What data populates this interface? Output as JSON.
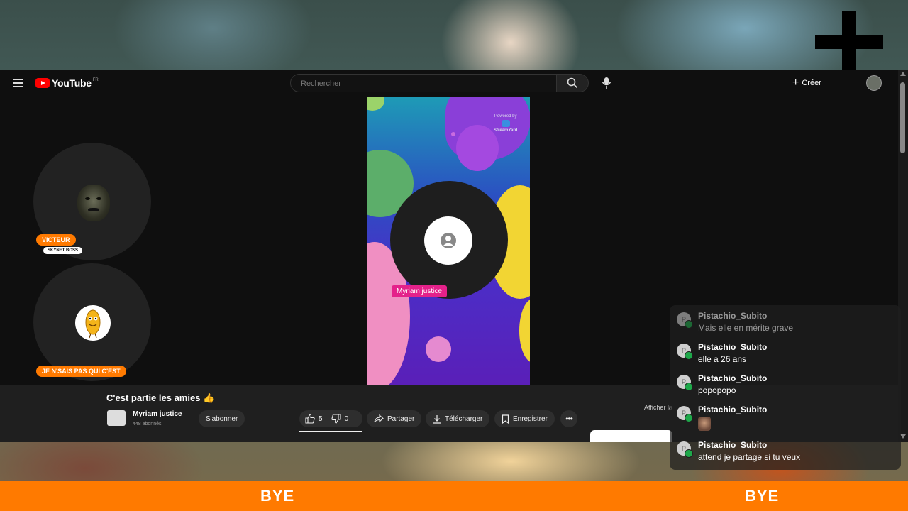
{
  "youtube": {
    "logo_text": "YouTube",
    "logo_region": "FR",
    "search_placeholder": "Rechercher",
    "create_label": "Créer"
  },
  "video": {
    "title": "C'est partie les amies 👍",
    "channel_name": "Myriam justice",
    "channel_subs": "448 abonnés",
    "subscribe_label": "S'abonner",
    "likes": "5",
    "dislikes": "0",
    "share_label": "Partager",
    "download_label": "Télécharger",
    "save_label": "Enregistrer",
    "show_more_label": "Afficher la",
    "participant_name": "Myriam justice",
    "watermark_top": "Powered by",
    "watermark_brand": "StreamYard"
  },
  "overlay": {
    "cam1_badge": "VICTEUR",
    "cam1_sub_badge": "SKYNET BOSS",
    "cam2_badge": "JE N'SAIS PAS QUI C'EST",
    "bottom_left": "BYE",
    "bottom_right": "BYE"
  },
  "chat": {
    "messages": [
      {
        "user": "Pistachio_Subito",
        "text": "Mais elle en mérite grave",
        "avatar_letter": "P"
      },
      {
        "user": "Pistachio_Subito",
        "text": "elle a 26 ans",
        "avatar_letter": "P"
      },
      {
        "user": "Pistachio_Subito",
        "text": "popopopo",
        "avatar_letter": "P"
      },
      {
        "user": "Pistachio_Subito",
        "text": "",
        "avatar_letter": "P"
      },
      {
        "user": "Pistachio_Subito",
        "text": "attend je partage si tu veux",
        "avatar_letter": "P"
      }
    ]
  },
  "colors": {
    "brand_orange": "#ff7a00",
    "youtube_red": "#ff0000",
    "name_tag_pink": "#e4218a",
    "online_green": "#1ea84a"
  }
}
